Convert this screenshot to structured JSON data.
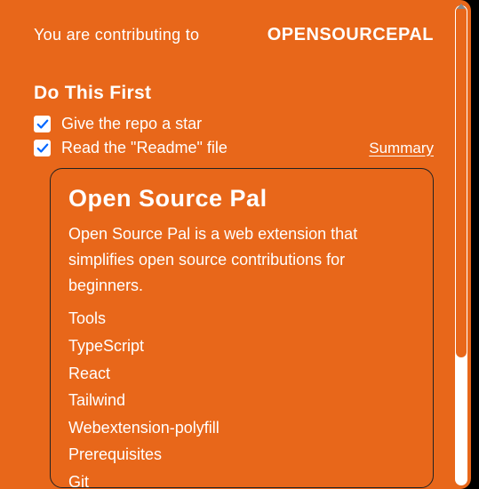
{
  "header": {
    "contrib_text": "You are contributing to",
    "app_name": "OPENSOURCEPAL"
  },
  "section": {
    "title": "Do This First"
  },
  "checklist": [
    {
      "label": "Give the repo a star",
      "checked": true
    },
    {
      "label": "Read the \"Readme\" file",
      "checked": true
    }
  ],
  "summary_link": "Summary",
  "readme": {
    "title": "Open Source Pal",
    "description": "Open Source Pal is a web extension that simplifies open source contributions for beginners.",
    "lines": [
      "Tools",
      "TypeScript",
      "React",
      "Tailwind",
      "Webextension-polyfill",
      "Prerequisites",
      "Git"
    ]
  }
}
